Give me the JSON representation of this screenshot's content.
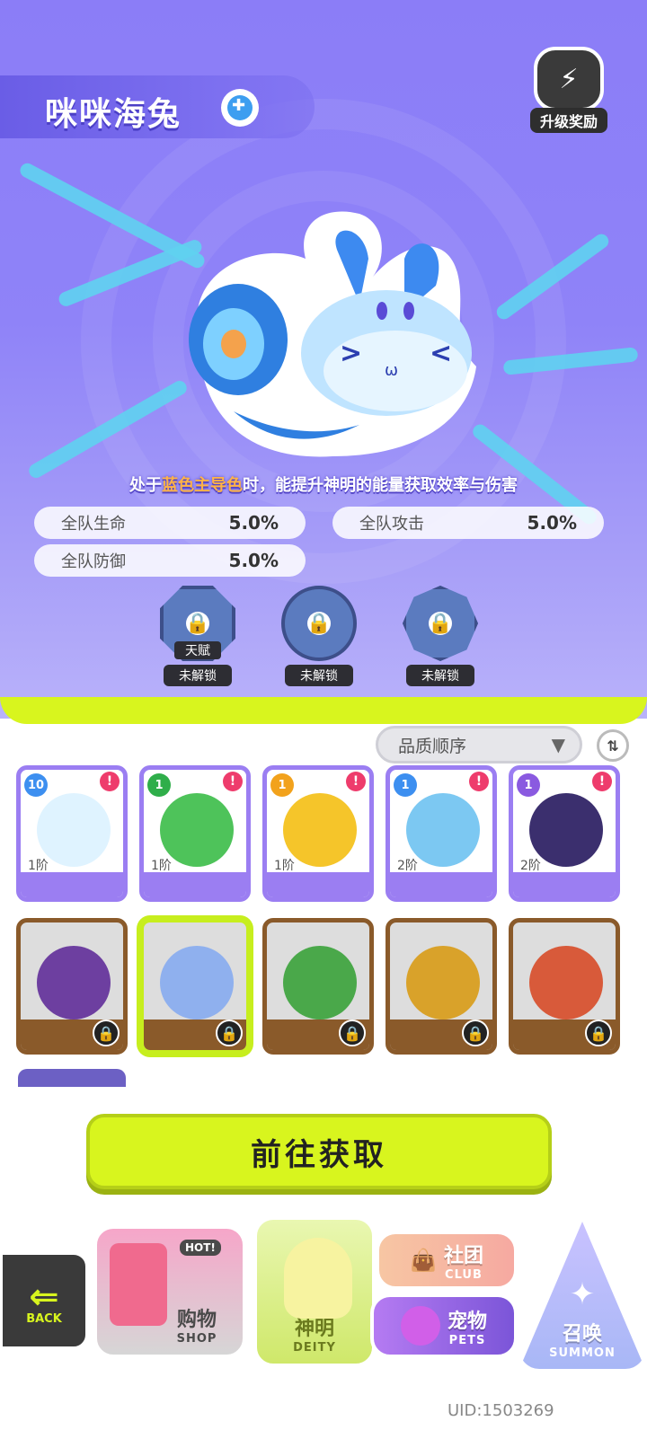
{
  "header": {
    "pet_name": "咪咪海兔",
    "element_icon": "water-element-icon",
    "upgrade_reward_label": "升级奖励"
  },
  "description": {
    "prefix": "处于",
    "highlight": "蓝色主导色",
    "suffix": "时，能提升神明的能量获取效率与伤害"
  },
  "stats": [
    {
      "label": "全队生命",
      "value": "5.0%"
    },
    {
      "label": "全队攻击",
      "value": "5.0%"
    },
    {
      "label": "全队防御",
      "value": "5.0%"
    }
  ],
  "skills": [
    {
      "tag": "天赋",
      "status": "未解锁"
    },
    {
      "status": "未解锁"
    },
    {
      "status": "未解锁"
    }
  ],
  "sort": {
    "label": "品质顺序"
  },
  "owned_pets": [
    {
      "level": "10",
      "rank": "1阶",
      "color": "#dff3ff"
    },
    {
      "level": "1",
      "rank": "1阶",
      "color": "#4ec35a"
    },
    {
      "level": "1",
      "rank": "1阶",
      "color": "#f5c52a"
    },
    {
      "level": "1",
      "rank": "2阶",
      "color": "#7cc8f2"
    },
    {
      "level": "1",
      "rank": "2阶",
      "color": "#3b2f6e"
    }
  ],
  "locked_pets": [
    {
      "color": "#6d3fa0",
      "selected": false
    },
    {
      "color": "#8fb0ee",
      "selected": true
    },
    {
      "color": "#4aa84a",
      "selected": false
    },
    {
      "color": "#d9a22a",
      "selected": false
    },
    {
      "color": "#d85a3a",
      "selected": false
    }
  ],
  "action_button": "前往获取",
  "nav": {
    "back": "BACK",
    "shop_cn": "购物",
    "shop_en": "SHOP",
    "shop_hot": "HOT!",
    "deity_cn": "神明",
    "deity_en": "DEITY",
    "club_cn": "社团",
    "club_en": "CLUB",
    "pets_cn": "宠物",
    "pets_en": "PETS",
    "summon_cn": "召唤",
    "summon_en": "SUMMON"
  },
  "uid": "UID:1503269"
}
